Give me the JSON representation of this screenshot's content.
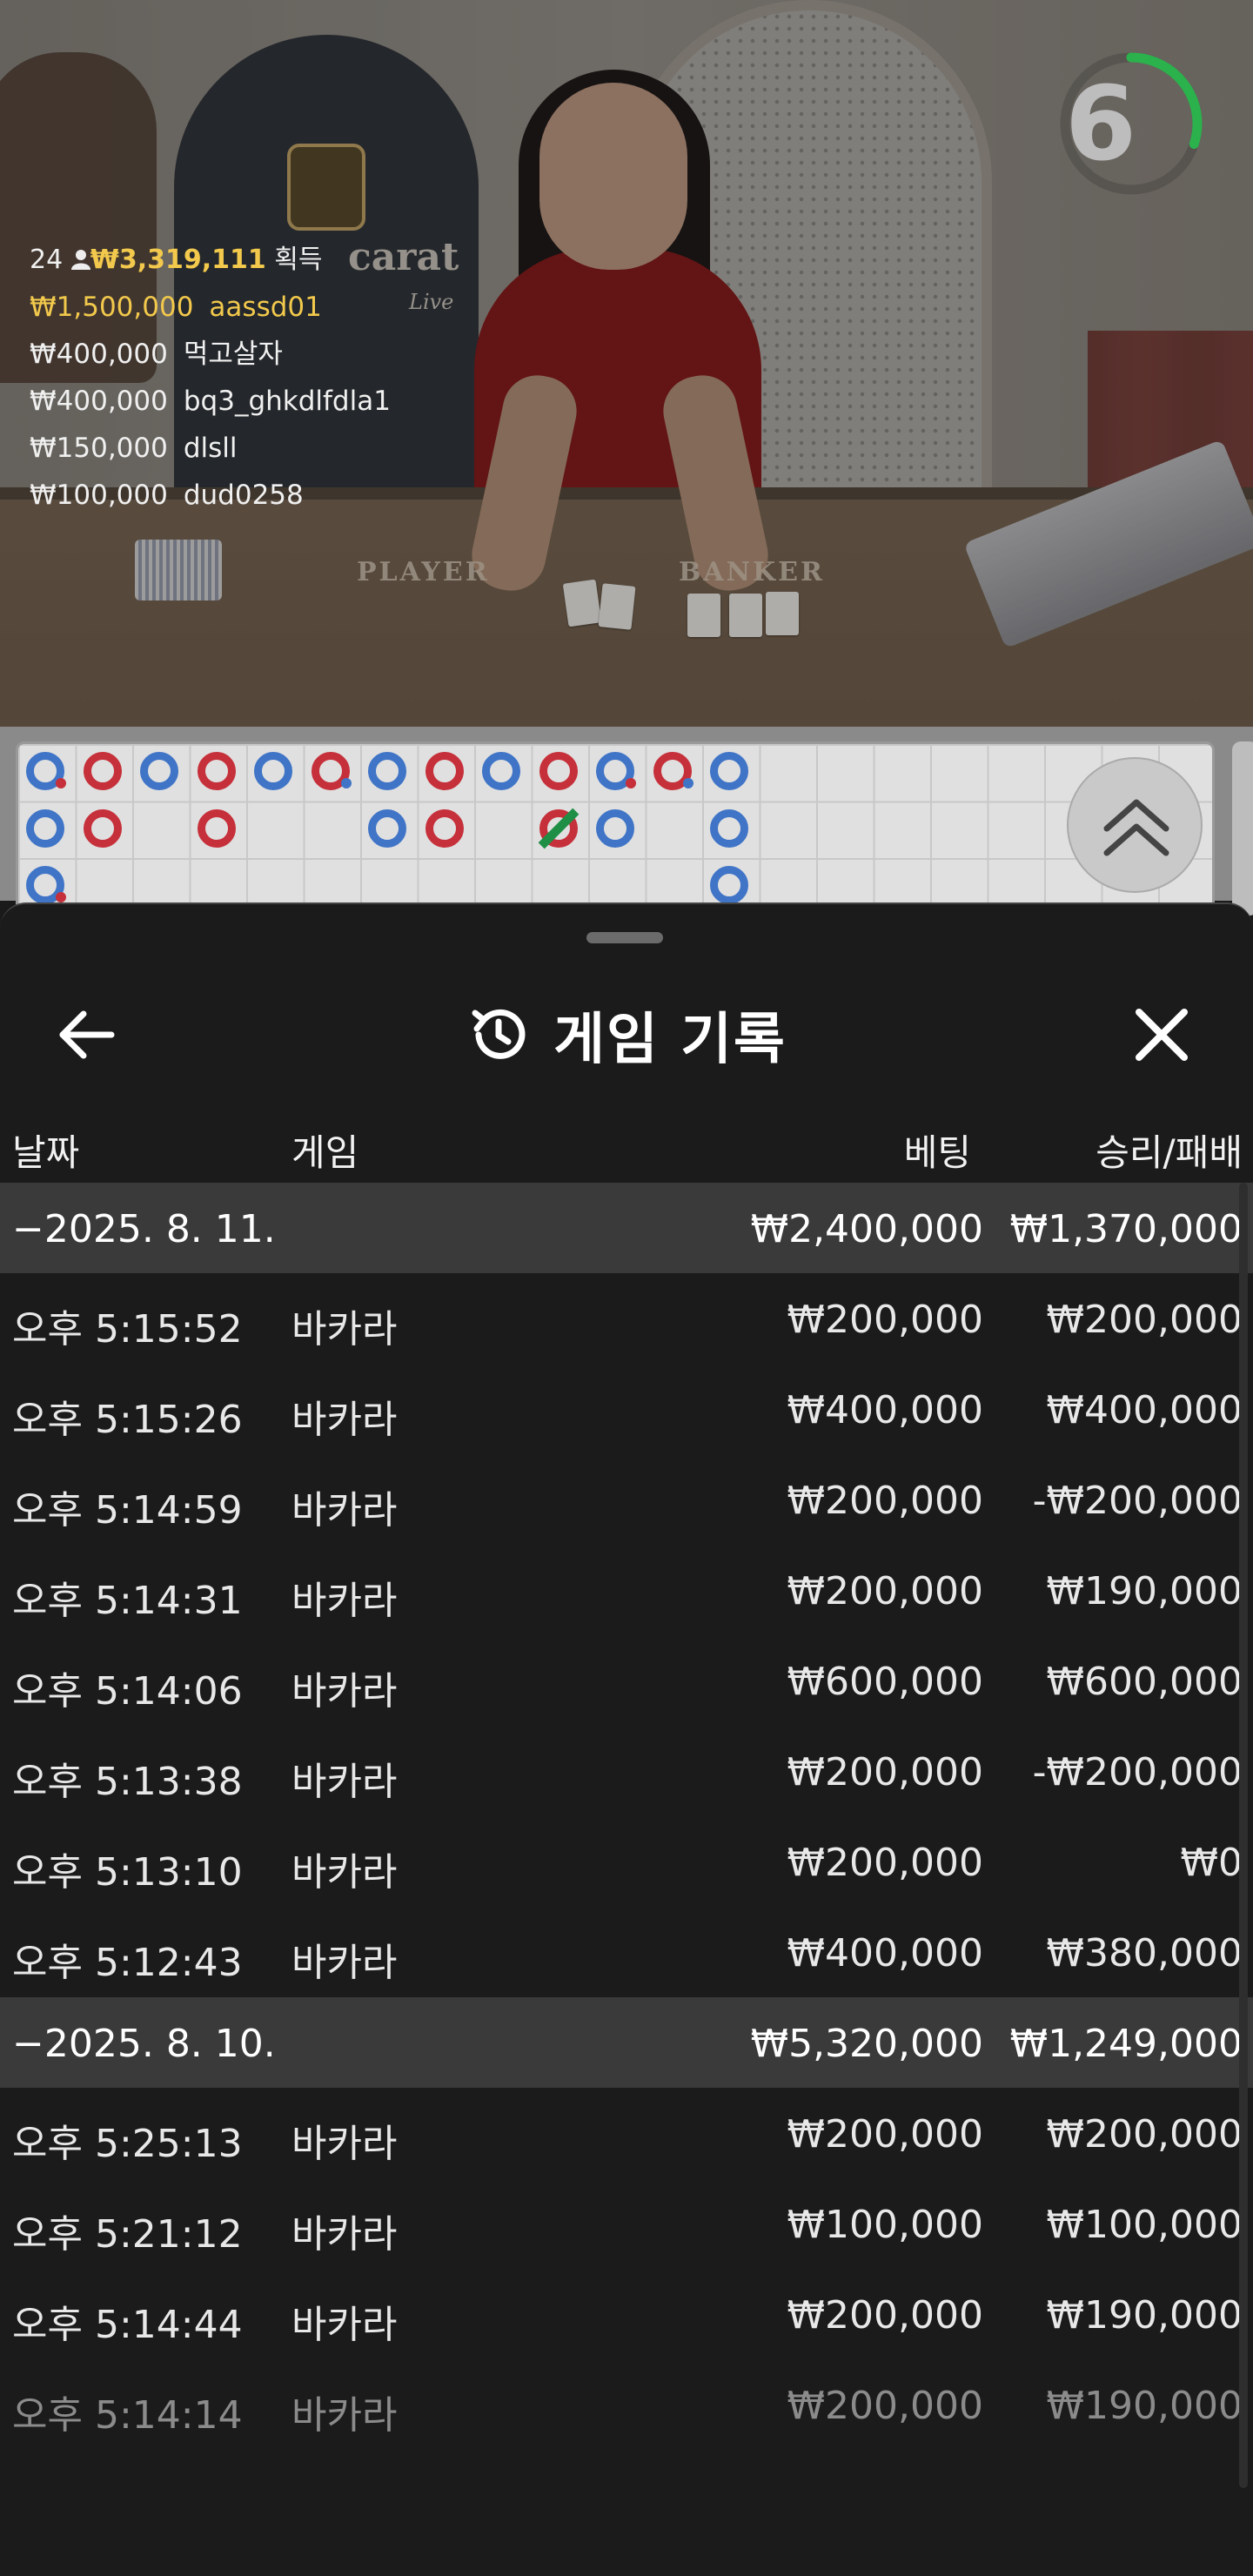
{
  "video": {
    "table_label_left": "PLAYER",
    "table_label_right": "BANKER",
    "logo_text": "carat",
    "logo_sub": "Live"
  },
  "winners": {
    "count": "24",
    "total": "₩3,319,111",
    "total_suffix": "획득",
    "entries": [
      {
        "amount": "₩1,500,000",
        "name": "aassd01"
      },
      {
        "amount": "₩400,000",
        "name": "먹고살자"
      },
      {
        "amount": "₩400,000",
        "name": "bq3_ghkdlfdla1"
      },
      {
        "amount": "₩150,000",
        "name": "dlsll"
      },
      {
        "amount": "₩100,000",
        "name": "dud0258"
      }
    ]
  },
  "timer": {
    "value": "6",
    "fraction": 0.3,
    "color": "#2bb24c"
  },
  "bead_road": {
    "colors": {
      "player": "#3f74c7",
      "banker": "#c6303a",
      "tie": "#1e8f45"
    },
    "toggle_icon": "double-chevron-up-icon"
  },
  "sheet": {
    "title": "게임 기록",
    "title_icon": "history-icon",
    "back_icon": "arrow-left-icon",
    "close_icon": "close-icon",
    "columns": {
      "date": "날짜",
      "game": "게임",
      "bet": "베팅",
      "winloss": "승리/패배"
    },
    "groups": [
      {
        "date": "−2025. 8. 11.",
        "bet_total": "₩2,400,000",
        "winloss_total": "₩1,370,000",
        "rows": [
          {
            "time": "오후 5:15:52",
            "game": "바카라",
            "bet": "₩200,000",
            "winloss": "₩200,000"
          },
          {
            "time": "오후 5:15:26",
            "game": "바카라",
            "bet": "₩400,000",
            "winloss": "₩400,000"
          },
          {
            "time": "오후 5:14:59",
            "game": "바카라",
            "bet": "₩200,000",
            "winloss": "-₩200,000"
          },
          {
            "time": "오후 5:14:31",
            "game": "바카라",
            "bet": "₩200,000",
            "winloss": "₩190,000"
          },
          {
            "time": "오후 5:14:06",
            "game": "바카라",
            "bet": "₩600,000",
            "winloss": "₩600,000"
          },
          {
            "time": "오후 5:13:38",
            "game": "바카라",
            "bet": "₩200,000",
            "winloss": "-₩200,000"
          },
          {
            "time": "오후 5:13:10",
            "game": "바카라",
            "bet": "₩200,000",
            "winloss": "₩0"
          },
          {
            "time": "오후 5:12:43",
            "game": "바카라",
            "bet": "₩400,000",
            "winloss": "₩380,000"
          }
        ]
      },
      {
        "date": "−2025. 8. 10.",
        "bet_total": "₩5,320,000",
        "winloss_total": "₩1,249,000",
        "rows": [
          {
            "time": "오후 5:25:13",
            "game": "바카라",
            "bet": "₩200,000",
            "winloss": "₩200,000"
          },
          {
            "time": "오후 5:21:12",
            "game": "바카라",
            "bet": "₩100,000",
            "winloss": "₩100,000"
          },
          {
            "time": "오후 5:14:44",
            "game": "바카라",
            "bet": "₩200,000",
            "winloss": "₩190,000"
          },
          {
            "time": "오후 5:14:14",
            "game": "바카라",
            "bet": "₩200,000",
            "winloss": "₩190,000"
          }
        ]
      }
    ]
  }
}
